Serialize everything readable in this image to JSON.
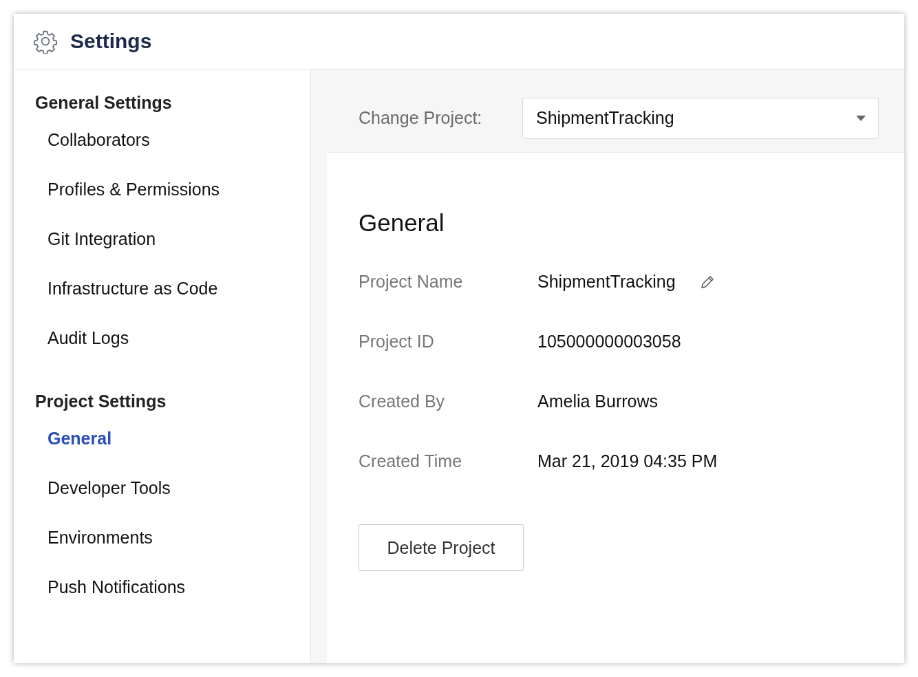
{
  "header": {
    "title": "Settings"
  },
  "sidebar": {
    "sections": [
      {
        "heading": "General Settings",
        "items": [
          {
            "label": "Collaborators",
            "selected": false
          },
          {
            "label": "Profiles & Permissions",
            "selected": false
          },
          {
            "label": "Git Integration",
            "selected": false
          },
          {
            "label": "Infrastructure as Code",
            "selected": false
          },
          {
            "label": "Audit Logs",
            "selected": false
          }
        ]
      },
      {
        "heading": "Project Settings",
        "items": [
          {
            "label": "General",
            "selected": true
          },
          {
            "label": "Developer Tools",
            "selected": false
          },
          {
            "label": "Environments",
            "selected": false
          },
          {
            "label": "Push Notifications",
            "selected": false
          }
        ]
      }
    ]
  },
  "project_selector": {
    "label": "Change Project:",
    "value": "ShipmentTracking"
  },
  "general": {
    "title": "General",
    "fields": [
      {
        "label": "Project Name",
        "value": "ShipmentTracking",
        "editable": true
      },
      {
        "label": "Project ID",
        "value": "105000000003058",
        "editable": false
      },
      {
        "label": "Created By",
        "value": "Amelia Burrows",
        "editable": false
      },
      {
        "label": "Created Time",
        "value": "Mar 21, 2019 04:35 PM",
        "editable": false
      }
    ],
    "delete_button": "Delete Project"
  }
}
